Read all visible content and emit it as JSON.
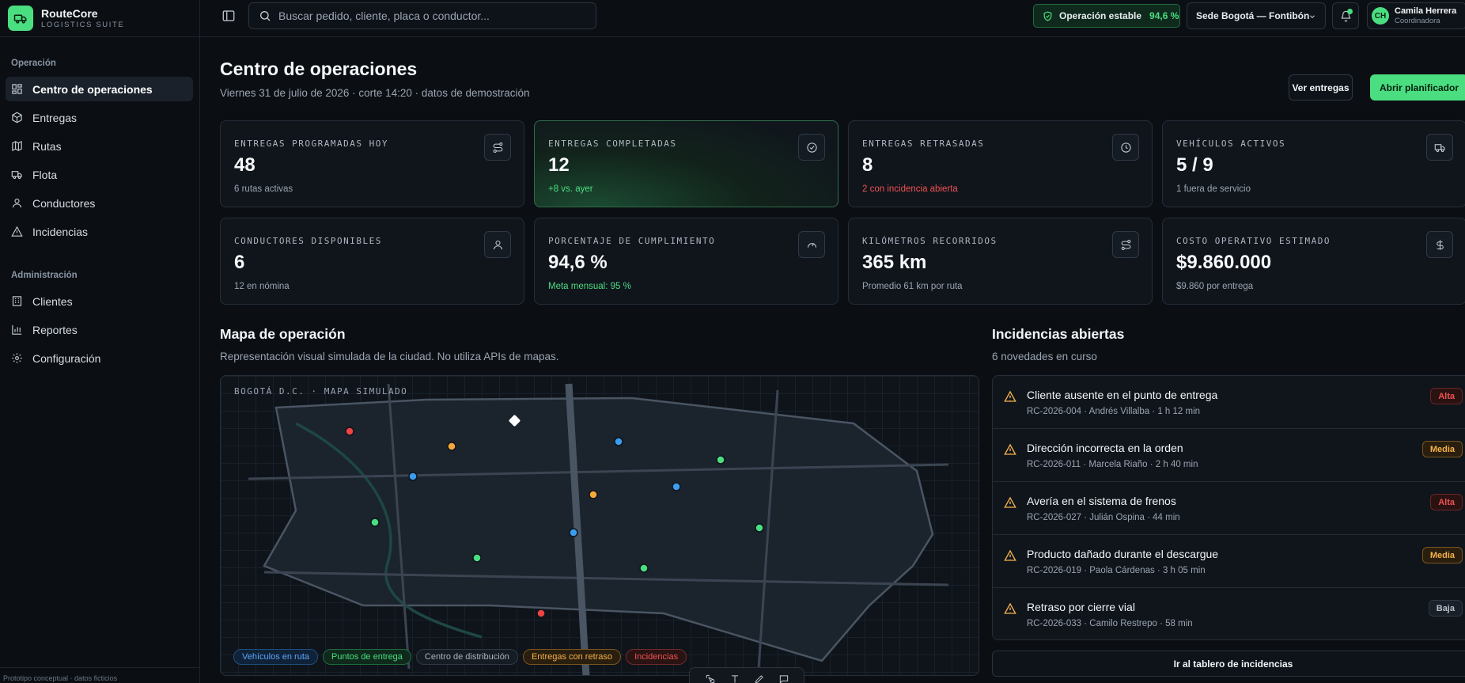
{
  "brand": {
    "name": "RouteCore",
    "subtitle": "LOGISTICS SUITE"
  },
  "sidebar": {
    "sections": [
      {
        "title": "Operación",
        "items": [
          {
            "label": "Centro de operaciones",
            "icon": "dashboard-icon",
            "active": true
          },
          {
            "label": "Entregas",
            "icon": "package-icon"
          },
          {
            "label": "Rutas",
            "icon": "map-icon"
          },
          {
            "label": "Flota",
            "icon": "truck-icon"
          },
          {
            "label": "Conductores",
            "icon": "user-icon"
          },
          {
            "label": "Incidencias",
            "icon": "alert-triangle-icon"
          }
        ]
      },
      {
        "title": "Administración",
        "items": [
          {
            "label": "Clientes",
            "icon": "building-icon"
          },
          {
            "label": "Reportes",
            "icon": "bar-chart-icon"
          },
          {
            "label": "Configuración",
            "icon": "gear-icon"
          }
        ]
      }
    ],
    "footer": "Prototipo conceptual · datos ficticios"
  },
  "topbar": {
    "search_placeholder": "Buscar pedido, cliente, placa o conductor...",
    "status_label": "Operación estable",
    "status_value": "94,6 %",
    "site": "Sede Bogotá — Fontibón",
    "user": {
      "initials": "CH",
      "name": "Camila Herrera",
      "role": "Coordinadora"
    }
  },
  "header": {
    "title": "Centro de operaciones",
    "subtitle": "Viernes 31 de julio de 2026 · corte 14:20 · datos de demostración",
    "btn_secondary": "Ver entregas",
    "btn_primary": "Abrir planificador"
  },
  "kpis": [
    {
      "label": "ENTREGAS PROGRAMADAS HOY",
      "value": "48",
      "note": "6 rutas activas",
      "tone": "neutral",
      "icon": "route-icon"
    },
    {
      "label": "ENTREGAS COMPLETADAS",
      "value": "12",
      "note": "+8 vs. ayer",
      "tone": "positive",
      "icon": "check-circle-icon"
    },
    {
      "label": "ENTREGAS RETRASADAS",
      "value": "8",
      "note": "2 con incidencia abierta",
      "tone": "negative",
      "icon": "clock-icon"
    },
    {
      "label": "VEHÍCULOS ACTIVOS",
      "value": "5 / 9",
      "note": "1 fuera de servicio",
      "tone": "neutral",
      "icon": "truck-icon"
    },
    {
      "label": "CONDUCTORES DISPONIBLES",
      "value": "6",
      "note": "12 en nómina",
      "tone": "neutral",
      "icon": "user-icon"
    },
    {
      "label": "PORCENTAJE DE CUMPLIMIENTO",
      "value": "94,6 %",
      "note": "Meta mensual: 95 %",
      "tone": "positive",
      "icon": "gauge-icon"
    },
    {
      "label": "KILÓMETROS RECORRIDOS",
      "value": "365 km",
      "note": "Promedio 61 km por ruta",
      "tone": "neutral",
      "icon": "route-icon"
    },
    {
      "label": "COSTO OPERATIVO ESTIMADO",
      "value": "$9.860.000",
      "note": "$9.860 por entrega",
      "tone": "neutral",
      "icon": "dollar-icon"
    }
  ],
  "map": {
    "title": "Mapa de operación",
    "subtitle": "Representación visual simulada de la ciudad. No utiliza APIs de mapas.",
    "caption": "BOGOTÁ D.C. · MAPA SIMULADO",
    "legend": [
      {
        "label": "Vehículos en ruta",
        "tone": "blue"
      },
      {
        "label": "Puntos de entrega",
        "tone": "green"
      },
      {
        "label": "Centro de distribución",
        "tone": "gray"
      },
      {
        "label": "Entregas con retraso",
        "tone": "orange"
      },
      {
        "label": "Incidencias",
        "tone": "red"
      }
    ],
    "colors": {
      "blue": "#3b9cf0",
      "green": "#4ade80",
      "orange": "#f5a83a",
      "red": "#ef4444",
      "hub": "#ffffff"
    }
  },
  "incidents": {
    "title": "Incidencias abiertas",
    "subtitle": "6 novedades en curso",
    "items": [
      {
        "title": "Cliente ausente en el punto de entrega",
        "meta": "RC-2026-004 · Andrés Villalba · 1 h 12 min",
        "severity": "Alta",
        "level": "alta"
      },
      {
        "title": "Dirección incorrecta en la orden",
        "meta": "RC-2026-011 · Marcela Riaño · 2 h 40 min",
        "severity": "Media",
        "level": "media"
      },
      {
        "title": "Avería en el sistema de frenos",
        "meta": "RC-2026-027 · Julián Ospina · 44 min",
        "severity": "Alta",
        "level": "alta"
      },
      {
        "title": "Producto dañado durante el descargue",
        "meta": "RC-2026-019 · Paola Cárdenas · 3 h 05 min",
        "severity": "Media",
        "level": "media"
      },
      {
        "title": "Retraso por cierre vial",
        "meta": "RC-2026-033 · Camilo Restrepo · 58 min",
        "severity": "Baja",
        "level": "baja"
      }
    ],
    "button": "Ir al tablero de incidencias"
  }
}
